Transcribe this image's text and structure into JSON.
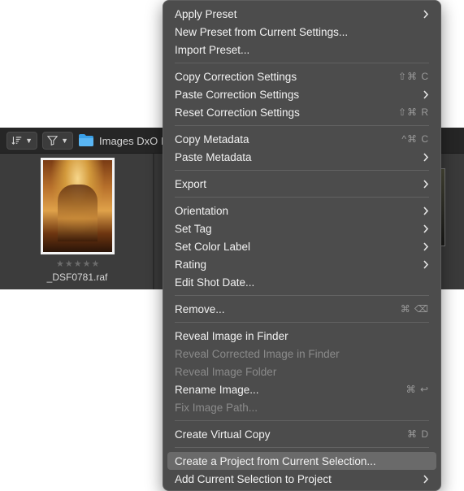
{
  "browser": {
    "sort_icon": "sort-icon",
    "filter_icon": "filter-icon",
    "folder_icon": "folder-icon",
    "folder_name": "Images DxO I",
    "thumbnail": {
      "stars": "★★★★★",
      "rating": 0,
      "filename": "_DSF0781.raf"
    }
  },
  "menu": {
    "groups": [
      [
        {
          "label": "Apply Preset",
          "submenu": true
        },
        {
          "label": "New Preset from Current Settings..."
        },
        {
          "label": "Import Preset..."
        }
      ],
      [
        {
          "label": "Copy Correction Settings",
          "shortcut": "⇧⌘ C"
        },
        {
          "label": "Paste Correction Settings",
          "submenu": true
        },
        {
          "label": "Reset Correction Settings",
          "shortcut": "⇧⌘ R"
        }
      ],
      [
        {
          "label": "Copy Metadata",
          "shortcut": "^⌘ C"
        },
        {
          "label": "Paste Metadata",
          "submenu": true
        }
      ],
      [
        {
          "label": "Export",
          "submenu": true
        }
      ],
      [
        {
          "label": "Orientation",
          "submenu": true
        },
        {
          "label": "Set Tag",
          "submenu": true
        },
        {
          "label": "Set Color Label",
          "submenu": true
        },
        {
          "label": "Rating",
          "submenu": true
        },
        {
          "label": "Edit Shot Date..."
        }
      ],
      [
        {
          "label": "Remove...",
          "shortcut": "⌘ ⌫"
        }
      ],
      [
        {
          "label": "Reveal Image in Finder"
        },
        {
          "label": "Reveal Corrected Image in Finder",
          "disabled": true
        },
        {
          "label": "Reveal Image Folder",
          "disabled": true
        },
        {
          "label": "Rename Image...",
          "shortcut": "⌘ ↩"
        },
        {
          "label": "Fix Image Path...",
          "disabled": true
        }
      ],
      [
        {
          "label": "Create Virtual Copy",
          "shortcut": "⌘ D"
        }
      ],
      [
        {
          "label": "Create a Project from Current Selection...",
          "active": true
        },
        {
          "label": "Add Current Selection to Project",
          "submenu": true
        }
      ]
    ]
  }
}
